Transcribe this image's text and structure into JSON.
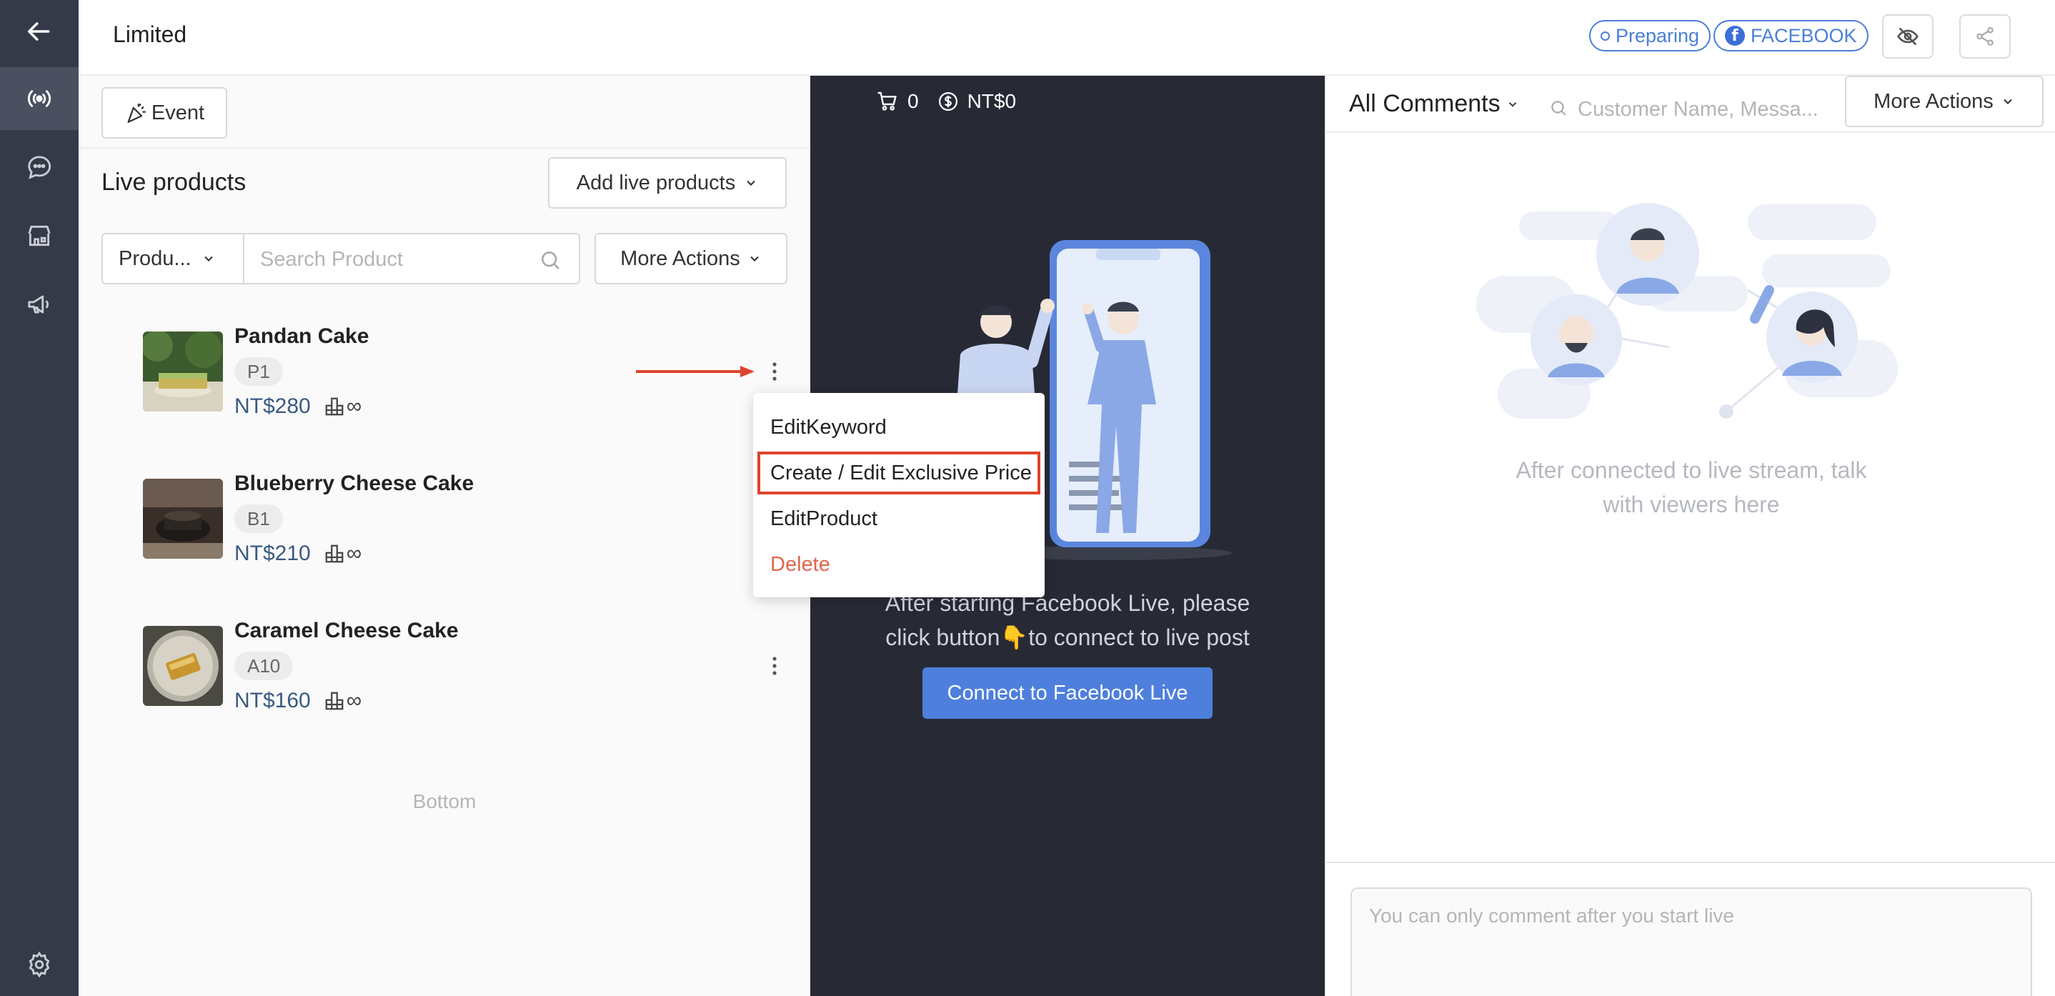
{
  "header": {
    "title": "Limited",
    "status_badge": "Preparing",
    "platform_badge": "FACEBOOK",
    "facebook_glyph": "f"
  },
  "rail": {
    "icons": [
      "back-arrow-icon",
      "live-broadcast-icon",
      "chat-icon",
      "shop-icon",
      "megaphone-icon",
      "gear-icon"
    ]
  },
  "left": {
    "event_button": "Event",
    "section_title": "Live products",
    "add_button": "Add live products",
    "product_select": "Produ...",
    "search_placeholder": "Search Product",
    "more_actions": "More Actions",
    "products": [
      {
        "name": "Pandan Cake",
        "code": "P1",
        "price": "NT$280",
        "stock": "∞"
      },
      {
        "name": "Blueberry Cheese Cake",
        "code": "B1",
        "price": "NT$210",
        "stock": "∞"
      },
      {
        "name": "Caramel Cheese Cake",
        "code": "A10",
        "price": "NT$160",
        "stock": "∞"
      }
    ],
    "bottom_text": "Bottom"
  },
  "menu": {
    "items": [
      "EditKeyword",
      "Create / Edit Exclusive Price",
      "EditProduct",
      "Delete"
    ],
    "highlighted_index": 1
  },
  "middle": {
    "cart_count": "0",
    "amount": "NT$0",
    "message_line1": "After starting Facebook Live, please",
    "message_line2": "click button👇to connect to live post",
    "connect_button": "Connect to Facebook Live"
  },
  "right": {
    "filter_label": "All Comments",
    "search_placeholder": "Customer Name, Messa...",
    "more_actions": "More Actions",
    "empty_line1": "After connected to live stream, talk",
    "empty_line2": "with viewers here",
    "comment_placeholder": "You can only comment after you start live"
  },
  "colors": {
    "rail_bg": "#353a48",
    "stage_bg": "#272a35",
    "accent": "#4e7fdc",
    "highlight": "#e0432c",
    "danger": "#e0664e"
  }
}
